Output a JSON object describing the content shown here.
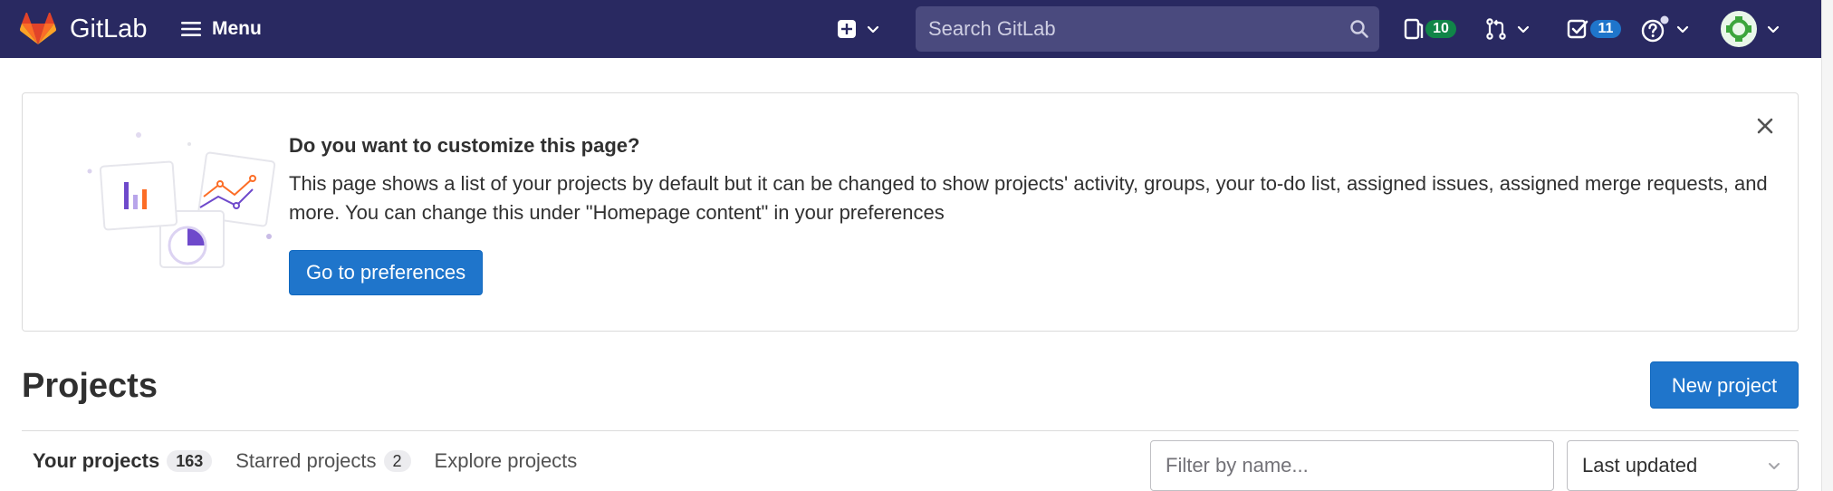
{
  "app": {
    "brand": "GitLab"
  },
  "topbar": {
    "menu_label": "Menu",
    "search_placeholder": "Search GitLab",
    "issues_count": "10",
    "todos_count": "11",
    "colors": {
      "bar": "#292961",
      "search": "#4a4a7e"
    }
  },
  "callout": {
    "title": "Do you want to customize this page?",
    "body": "This page shows a list of your projects by default but it can be changed to show projects' activity, groups, your to-do list, assigned issues, assigned merge requests, and more. You can change this under \"Homepage content\" in your preferences",
    "button_label": "Go to preferences"
  },
  "projects": {
    "title": "Projects",
    "new_button_label": "New project",
    "tabs": [
      {
        "label": "Your projects",
        "count": "163"
      },
      {
        "label": "Starred projects",
        "count": "2"
      },
      {
        "label": "Explore projects",
        "count": ""
      }
    ],
    "filter_placeholder": "Filter by name...",
    "sort_selected": "Last updated"
  },
  "icons": {
    "logo": "gitlab-tanuki-icon",
    "menu": "hamburger-icon",
    "new": "plus-square-icon",
    "search": "search-icon",
    "issues": "issues-icon",
    "merge_requests": "merge-request-icon",
    "todos": "todo-check-icon",
    "help": "help-circle-icon",
    "close": "close-icon",
    "chevron": "chevron-down-icon"
  }
}
